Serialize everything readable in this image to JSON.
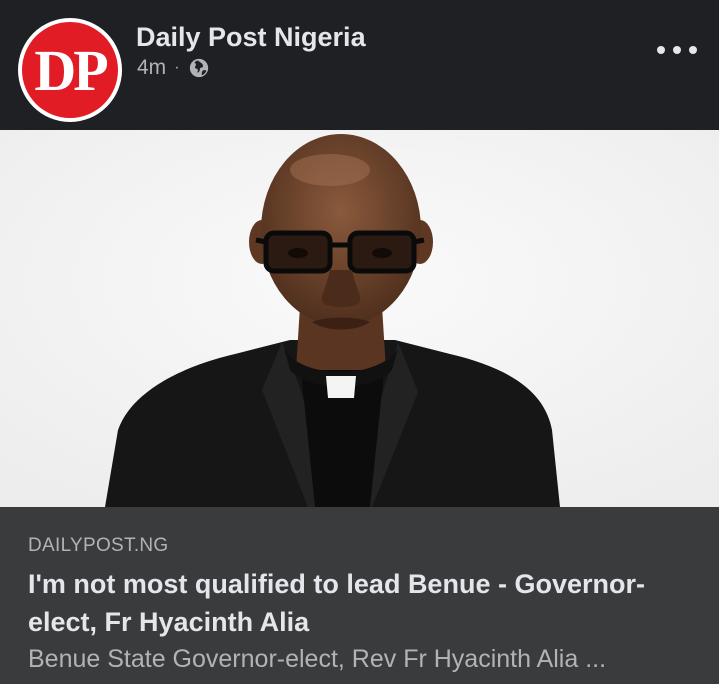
{
  "header": {
    "avatar_text": "DP",
    "page_name": "Daily Post Nigeria",
    "time": "4m",
    "separator": "·",
    "audience_icon": "globe-icon",
    "more_icon": "more-horizontal-icon"
  },
  "photo": {
    "subject": "portrait-photo"
  },
  "link_preview": {
    "domain": "DAILYPOST.NG",
    "title": "I'm not most qualified to lead Benue - Governor-elect, Fr Hyacinth Alia",
    "description": "Benue State Governor-elect, Rev Fr Hyacinth Alia ..."
  },
  "colors": {
    "background": "#242526",
    "header_bg": "#1f2023",
    "link_bg": "#3a3b3c",
    "brand_red": "#e11c24",
    "primary_text": "#e4e6eb",
    "secondary_text": "#b0b3b8"
  }
}
